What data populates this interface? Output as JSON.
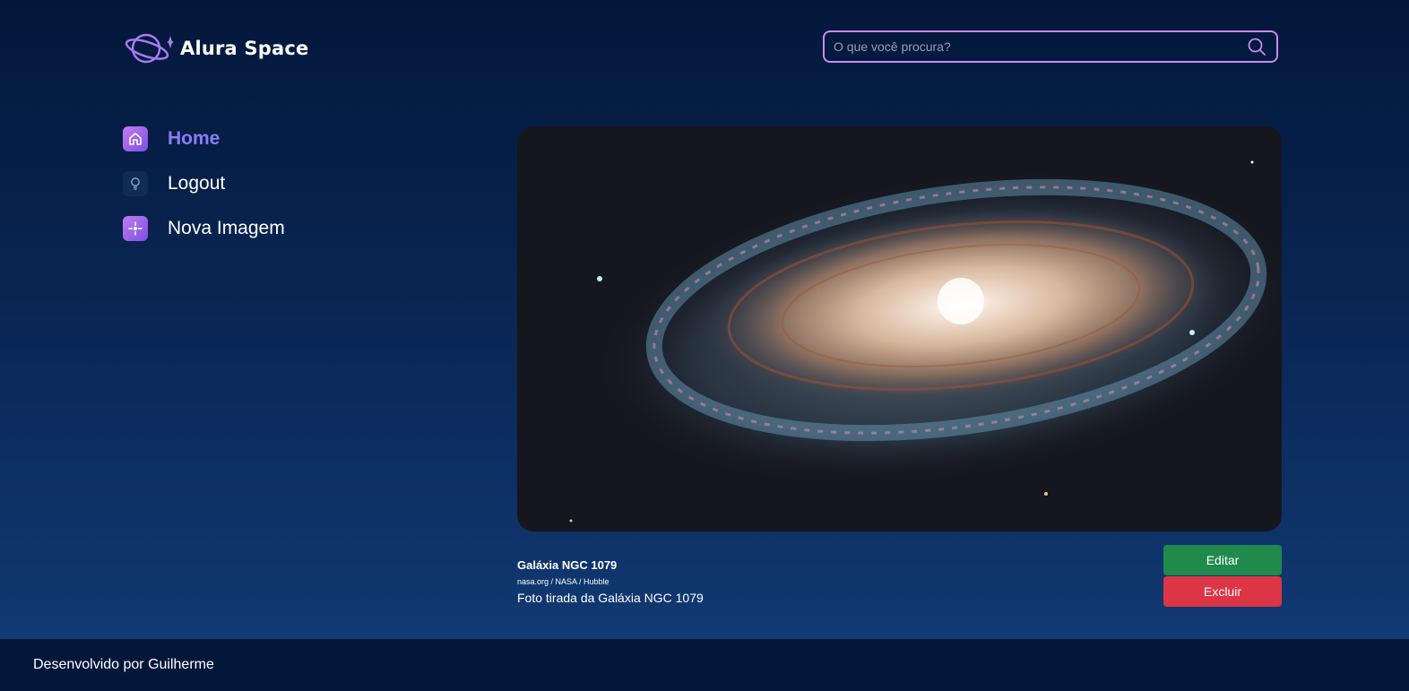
{
  "header": {
    "logo_text": "Alura Space",
    "search_placeholder": "O que você procura?"
  },
  "sidebar": {
    "items": [
      {
        "label": "Home",
        "icon": "home-icon",
        "active": true
      },
      {
        "label": "Logout",
        "icon": "lightbulb-icon",
        "active": false
      },
      {
        "label": "Nova Imagem",
        "icon": "sparkle-icon",
        "active": false
      }
    ]
  },
  "photo": {
    "title": "Galáxia NGC 1079",
    "source": "nasa.org / NASA / Hubble",
    "description": "Foto tirada da Galáxia NGC 1079"
  },
  "actions": {
    "edit_label": "Editar",
    "delete_label": "Excluir"
  },
  "footer": {
    "text": "Desenvolvido por Guilherme"
  },
  "colors": {
    "accent": "#8a7cf6",
    "search_border": "#c98cf1",
    "edit": "#1f8a4c",
    "delete": "#dc3545",
    "footer_bg": "#03173a"
  }
}
